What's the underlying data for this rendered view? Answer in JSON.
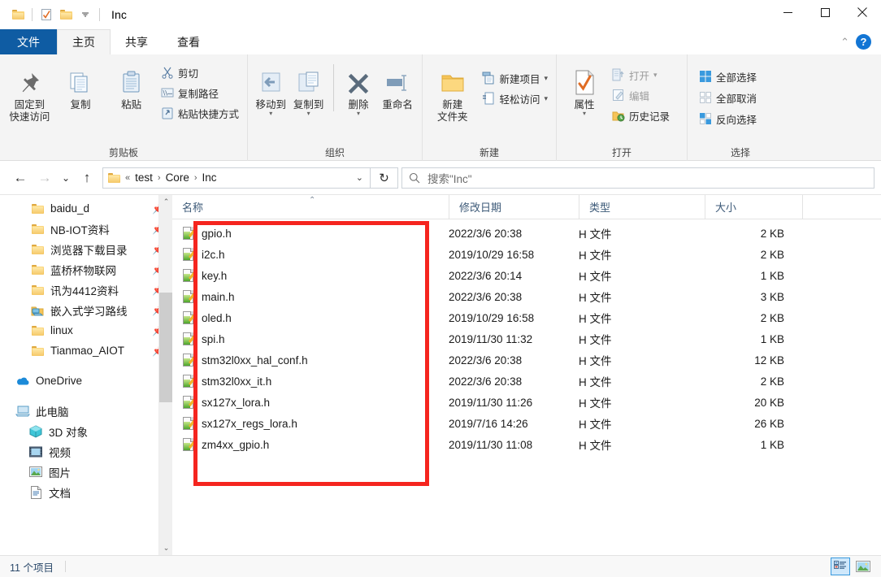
{
  "window": {
    "title": "Inc",
    "quick_access": [
      "folder-icon",
      "properties-check-icon",
      "new-folder-icon",
      "dropdown-caret"
    ],
    "controls": {
      "minimize": "—",
      "maximize": "□",
      "close": "✕"
    }
  },
  "ribbon": {
    "tabs": [
      {
        "label": "文件",
        "state": "file"
      },
      {
        "label": "主页",
        "state": "active"
      },
      {
        "label": "共享",
        "state": "normal"
      },
      {
        "label": "查看",
        "state": "normal"
      }
    ],
    "collapse_icon": "⌃",
    "help_icon": "?",
    "groups": [
      {
        "title": "剪贴板",
        "big": [
          {
            "label": "固定到\n快速访问",
            "line1": "固定到",
            "line2": "快速访问",
            "icon": "pin-icon"
          },
          {
            "line1": "复制",
            "line2": "",
            "icon": "copy-icon"
          },
          {
            "line1": "粘贴",
            "line2": "",
            "icon": "paste-icon"
          }
        ],
        "small": [
          {
            "label": "剪切",
            "icon": "scissors-icon",
            "dim": false
          },
          {
            "label": "复制路径",
            "icon": "copy-path-icon",
            "dim": false
          },
          {
            "label": "粘贴快捷方式",
            "icon": "paste-shortcut-icon",
            "dim": false
          }
        ]
      },
      {
        "title": "组织",
        "big": [
          {
            "line1": "移动到",
            "line2": "",
            "icon": "move-to-icon",
            "caret": true
          },
          {
            "line1": "复制到",
            "line2": "",
            "icon": "copy-to-icon",
            "caret": true
          },
          {
            "line1": "删除",
            "line2": "",
            "icon": "delete-icon",
            "caret": true
          },
          {
            "line1": "重命名",
            "line2": "",
            "icon": "rename-icon",
            "caret": false
          }
        ],
        "small": []
      },
      {
        "title": "新建",
        "big": [
          {
            "line1": "新建",
            "line2": "文件夹",
            "icon": "new-folder-icon"
          }
        ],
        "small": [
          {
            "label": "新建项目",
            "icon": "new-item-icon",
            "caret": true
          },
          {
            "label": "轻松访问",
            "icon": "easy-access-icon",
            "caret": true
          }
        ]
      },
      {
        "title": "打开",
        "big": [
          {
            "line1": "属性",
            "line2": "",
            "icon": "properties-icon",
            "caret": true
          }
        ],
        "small": [
          {
            "label": "打开",
            "icon": "open-icon",
            "dim": true,
            "caret": true
          },
          {
            "label": "编辑",
            "icon": "edit-icon",
            "dim": true
          },
          {
            "label": "历史记录",
            "icon": "history-icon",
            "dim": false
          }
        ]
      },
      {
        "title": "选择",
        "big": [],
        "small": [
          {
            "label": "全部选择",
            "icon": "select-all-icon"
          },
          {
            "label": "全部取消",
            "icon": "select-none-icon"
          },
          {
            "label": "反向选择",
            "icon": "invert-selection-icon"
          }
        ]
      }
    ]
  },
  "navbar": {
    "back_icon": "←",
    "forward_icon": "→",
    "recent_icon": "⌄",
    "up_icon": "↑",
    "breadcrumb_overflow": "«",
    "breadcrumbs": [
      "test",
      "Core",
      "Inc"
    ],
    "breadcrumb_sep": "›",
    "address_dropdown": "⌄",
    "refresh_icon": "↻",
    "search_icon": "search-icon",
    "search_placeholder": "搜索\"Inc\""
  },
  "sidebar": {
    "quick_items": [
      {
        "label": "baidu_d",
        "icon": "folder-icon",
        "pinned": true
      },
      {
        "label": "NB-IOT资料",
        "icon": "folder-icon",
        "pinned": true
      },
      {
        "label": "浏览器下载目录",
        "icon": "folder-icon",
        "pinned": true
      },
      {
        "label": "蓝桥杯物联网",
        "icon": "folder-icon",
        "pinned": true
      },
      {
        "label": "讯为4412资料",
        "icon": "folder-icon",
        "pinned": true
      },
      {
        "label": "嵌入式学习路线",
        "icon": "network-folder-icon",
        "pinned": true
      },
      {
        "label": "linux",
        "icon": "folder-icon",
        "pinned": true
      },
      {
        "label": "Tianmao_AIOT",
        "icon": "folder-icon",
        "pinned": true
      }
    ],
    "onedrive": {
      "label": "OneDrive",
      "icon": "cloud-icon"
    },
    "thispc": {
      "label": "此电脑",
      "icon": "computer-icon"
    },
    "pc_items": [
      {
        "label": "3D 对象",
        "icon": "3d-objects-icon"
      },
      {
        "label": "视频",
        "icon": "videos-icon"
      },
      {
        "label": "图片",
        "icon": "pictures-icon"
      },
      {
        "label": "文档",
        "icon": "documents-icon"
      }
    ],
    "scroll_up": "⌃",
    "scroll_down": "⌄"
  },
  "filelist": {
    "columns": [
      {
        "label": "名称",
        "key": "name"
      },
      {
        "label": "修改日期",
        "key": "date"
      },
      {
        "label": "类型",
        "key": "type"
      },
      {
        "label": "大小",
        "key": "size"
      }
    ],
    "sort_indicator": "⌃",
    "rows": [
      {
        "name": "gpio.h",
        "date": "2022/3/6 20:38",
        "type": "H 文件",
        "size": "2 KB"
      },
      {
        "name": "i2c.h",
        "date": "2019/10/29 16:58",
        "type": "H 文件",
        "size": "2 KB"
      },
      {
        "name": "key.h",
        "date": "2022/3/6 20:14",
        "type": "H 文件",
        "size": "1 KB"
      },
      {
        "name": "main.h",
        "date": "2022/3/6 20:38",
        "type": "H 文件",
        "size": "3 KB"
      },
      {
        "name": "oled.h",
        "date": "2019/10/29 16:58",
        "type": "H 文件",
        "size": "2 KB"
      },
      {
        "name": "spi.h",
        "date": "2019/11/30 11:32",
        "type": "H 文件",
        "size": "1 KB"
      },
      {
        "name": "stm32l0xx_hal_conf.h",
        "date": "2022/3/6 20:38",
        "type": "H 文件",
        "size": "12 KB"
      },
      {
        "name": "stm32l0xx_it.h",
        "date": "2022/3/6 20:38",
        "type": "H 文件",
        "size": "2 KB"
      },
      {
        "name": "sx127x_lora.h",
        "date": "2019/11/30 11:26",
        "type": "H 文件",
        "size": "20 KB"
      },
      {
        "name": "sx127x_regs_lora.h",
        "date": "2019/7/16 14:26",
        "type": "H 文件",
        "size": "26 KB"
      },
      {
        "name": "zm4xx_gpio.h",
        "date": "2019/11/30 11:08",
        "type": "H 文件",
        "size": "1 KB"
      }
    ]
  },
  "annotation": {
    "color": "#f5251f",
    "shape": "rectangle"
  },
  "statusbar": {
    "item_count": "11 个项目",
    "view_details": "details-view-icon",
    "view_large_icons": "large-icons-view-icon"
  },
  "colors": {
    "file_tab_blue": "#0f5ca3",
    "annotation_red": "#f5251f",
    "column_header_text": "#3d5a78",
    "status_text": "#2c4a6b"
  }
}
